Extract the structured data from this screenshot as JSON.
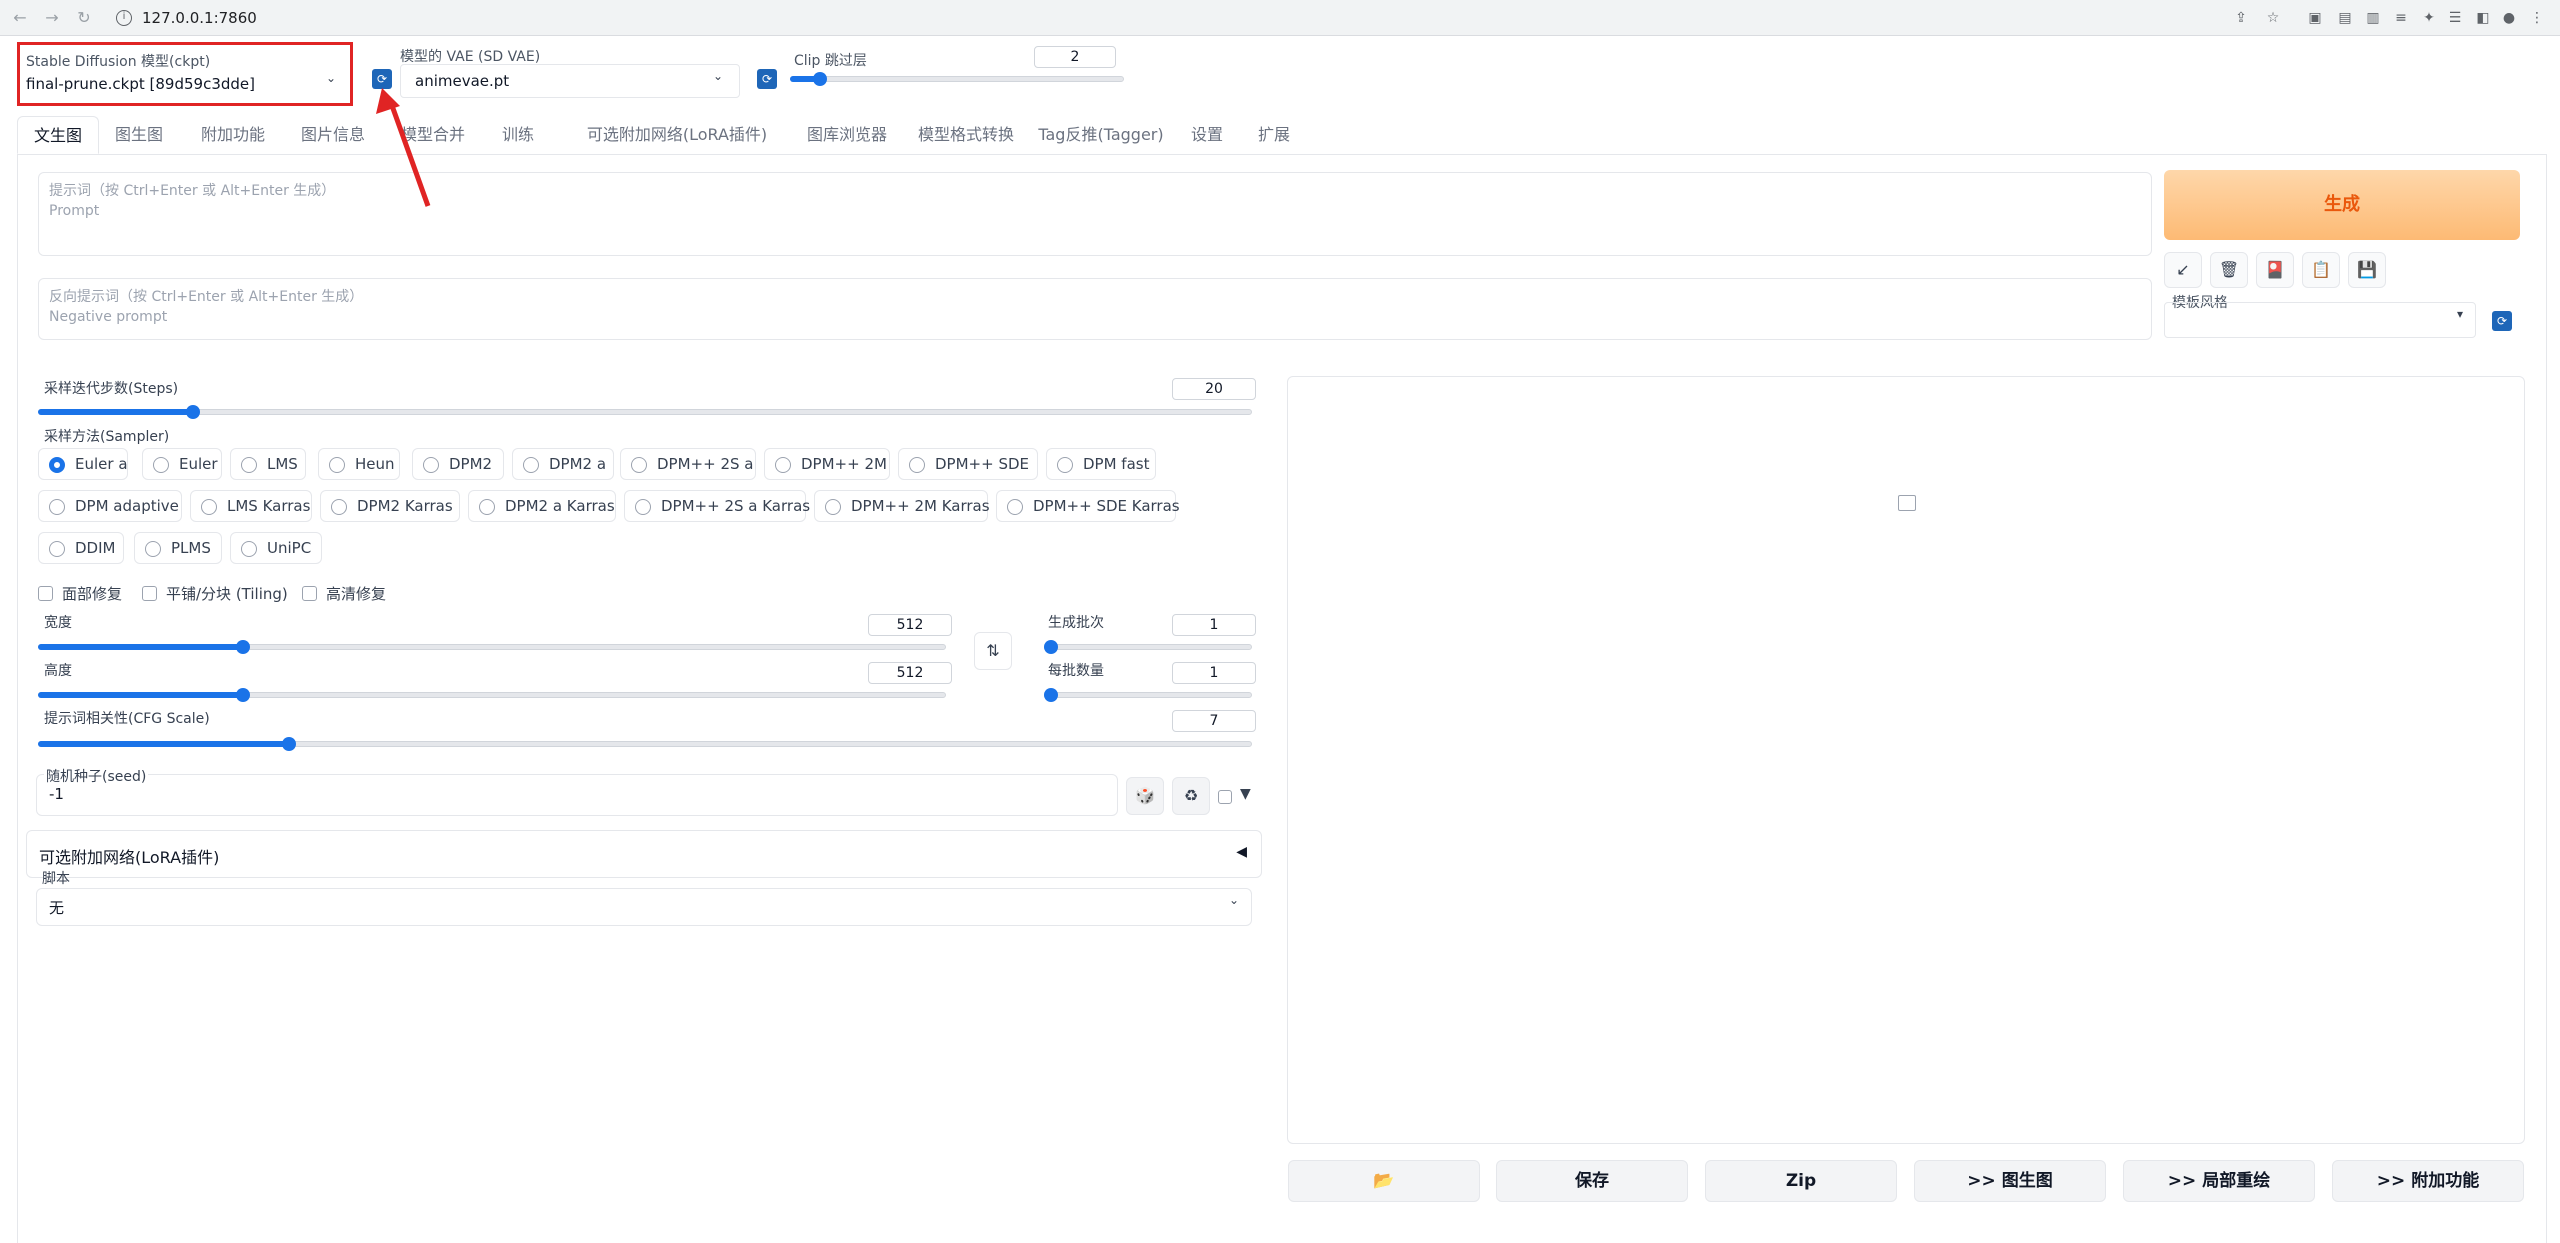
{
  "browser": {
    "url": "127.0.0.1:7860",
    "back_icon": "back-arrow-icon",
    "forward_icon": "forward-arrow-icon",
    "reload_icon": "reload-icon"
  },
  "top_settings": {
    "ckpt_label": "Stable Diffusion 模型(ckpt)",
    "ckpt_value": "final-prune.ckpt [89d59c3dde]",
    "vae_label": "模型的 VAE (SD VAE)",
    "vae_value": "animevae.pt",
    "clip_label": "Clip 跳过层",
    "clip_value": "2",
    "clip_min": 1,
    "clip_max": 12
  },
  "tabs": [
    {
      "label": "文生图"
    },
    {
      "label": "图生图"
    },
    {
      "label": "附加功能"
    },
    {
      "label": "图片信息"
    },
    {
      "label": "模型合并"
    },
    {
      "label": "训练"
    },
    {
      "label": "可选附加网络(LoRA插件)"
    },
    {
      "label": "图库浏览器"
    },
    {
      "label": "模型格式转换"
    },
    {
      "label": "Tag反推(Tagger)"
    },
    {
      "label": "设置"
    },
    {
      "label": "扩展"
    }
  ],
  "active_tab": "文生图",
  "prompt": {
    "label": "提示词（按 Ctrl+Enter 或 Alt+Enter 生成）",
    "placeholder": "Prompt"
  },
  "negative_prompt": {
    "label": "反向提示词（按 Ctrl+Enter 或 Alt+Enter 生成）",
    "placeholder": "Negative prompt"
  },
  "generate_label": "生成",
  "tool_buttons": [
    "↙",
    "🗑",
    "🎴",
    "📋",
    "💾"
  ],
  "style_label": "模板风格",
  "steps": {
    "label": "采样迭代步数(Steps)",
    "value": "20",
    "min": 1,
    "max": 150
  },
  "sampler": {
    "label": "采样方法(Sampler)",
    "selected": "Euler a",
    "options_row1": [
      "Euler a",
      "Euler",
      "LMS",
      "Heun",
      "DPM2",
      "DPM2 a",
      "DPM++ 2S a",
      "DPM++ 2M",
      "DPM++ SDE",
      "DPM fast"
    ],
    "options_row2": [
      "DPM adaptive",
      "LMS Karras",
      "DPM2 Karras",
      "DPM2 a Karras",
      "DPM++ 2S a Karras",
      "DPM++ 2M Karras",
      "DPM++ SDE Karras"
    ],
    "options_row3": [
      "DDIM",
      "PLMS",
      "UniPC"
    ]
  },
  "checkboxes": {
    "face_restore": "面部修复",
    "tiling": "平铺/分块 (Tiling)",
    "hires": "高清修复"
  },
  "width": {
    "label": "宽度",
    "value": "512",
    "min": 64,
    "max": 2048
  },
  "height": {
    "label": "高度",
    "value": "512",
    "min": 64,
    "max": 2048
  },
  "batch_count": {
    "label": "生成批次",
    "value": "1",
    "min": 1,
    "max": 100
  },
  "batch_size": {
    "label": "每批数量",
    "value": "1",
    "min": 1,
    "max": 8
  },
  "cfg": {
    "label": "提示词相关性(CFG Scale)",
    "value": "7",
    "min": 1,
    "max": 30
  },
  "seed": {
    "label": "随机种子(seed)",
    "value": "-1"
  },
  "lora_accordion": "可选附加网络(LoRA插件)",
  "script": {
    "label": "脚本",
    "value": "无"
  },
  "bottom_buttons": [
    "📂",
    "保存",
    "Zip",
    ">> 图生图",
    ">> 局部重绘",
    ">> 附加功能"
  ],
  "colors": {
    "accent": "#1a73e8",
    "generate_text": "#ea580c",
    "highlight_border": "#e02424",
    "annotation_arrow": "#e02424"
  }
}
